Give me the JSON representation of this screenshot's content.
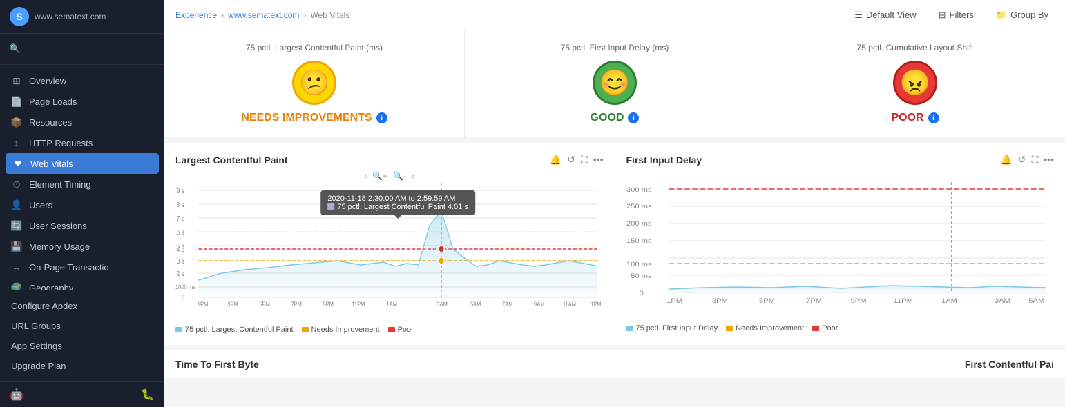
{
  "app": {
    "logo_text": "www.sematext.com",
    "logo_symbol": "S"
  },
  "sidebar": {
    "items": [
      {
        "id": "overview",
        "label": "Overview",
        "icon": "⊞"
      },
      {
        "id": "page-loads",
        "label": "Page Loads",
        "icon": "📄"
      },
      {
        "id": "resources",
        "label": "Resources",
        "icon": "📦"
      },
      {
        "id": "http-requests",
        "label": "HTTP Requests",
        "icon": "↕"
      },
      {
        "id": "web-vitals",
        "label": "Web Vitals",
        "icon": "❤"
      },
      {
        "id": "element-timing",
        "label": "Element Timing",
        "icon": "⏱"
      },
      {
        "id": "users",
        "label": "Users",
        "icon": "👤"
      },
      {
        "id": "user-sessions",
        "label": "User Sessions",
        "icon": "🔄"
      },
      {
        "id": "memory-usage",
        "label": "Memory Usage",
        "icon": "💾"
      },
      {
        "id": "on-page-transactions",
        "label": "On-Page Transactio",
        "icon": "↔"
      },
      {
        "id": "geography",
        "label": "Geography",
        "icon": "🌍"
      }
    ],
    "bottom_items": [
      {
        "id": "configure-apdex",
        "label": "Configure Apdex"
      },
      {
        "id": "url-groups",
        "label": "URL Groups"
      },
      {
        "id": "app-settings",
        "label": "App Settings"
      },
      {
        "id": "upgrade-plan",
        "label": "Upgrade Plan"
      }
    ]
  },
  "breadcrumb": {
    "items": [
      "Experience",
      "www.sematext.com",
      "Web Vitals"
    ]
  },
  "toolbar": {
    "default_view_label": "Default View",
    "filters_label": "Filters",
    "group_by_label": "Group By"
  },
  "score_cards": [
    {
      "title": "75 pctl. Largest Contentful Paint (ms)",
      "emoji": "😕",
      "emoji_style": "yellow",
      "label": "NEEDS IMPROVEMENTS",
      "label_style": "orange"
    },
    {
      "title": "75 pctl. First Input Delay (ms)",
      "emoji": "😊",
      "emoji_style": "green",
      "label": "GOOD",
      "label_style": "green"
    },
    {
      "title": "75 pctl. Cumulative Layout Shift",
      "emoji": "😠",
      "emoji_style": "red",
      "label": "POOR",
      "label_style": "red"
    }
  ],
  "charts": {
    "left": {
      "title": "Largest Contentful Paint",
      "tooltip": {
        "date": "2020-11-18 2:30:00 AM to 2:59:59 AM",
        "value": "75 pctl. Largest Contentful Paint  4.01 s"
      },
      "y_labels": [
        "9 s",
        "8 s",
        "7 s",
        "6 s",
        "5 s",
        "4 s",
        "3 s",
        "2 s",
        "1000 ms",
        "0"
      ],
      "x_labels": [
        "1PM",
        "3PM",
        "5PM",
        "7PM",
        "9PM",
        "11PM",
        "1AM",
        "3AM",
        "5AM",
        "7AM",
        "9AM",
        "11AM",
        "1PM"
      ],
      "legend": [
        {
          "label": "75 pctl. Largest Contentful Paint",
          "color": "#7ec8e3"
        },
        {
          "label": "Needs Improvement",
          "color": "#f0a500"
        },
        {
          "label": "Poor",
          "color": "#e53935"
        }
      ]
    },
    "right": {
      "title": "First Input Delay",
      "y_labels": [
        "300 ms",
        "250 ms",
        "200 ms",
        "150 ms",
        "100 ms",
        "50 ms",
        "0"
      ],
      "x_labels": [
        "1PM",
        "3PM",
        "5PM",
        "7PM",
        "9PM",
        "11PM",
        "1AM",
        "3AM",
        "5AM"
      ],
      "legend": [
        {
          "label": "75 pctl. First Input Delay",
          "color": "#7ec8e3"
        },
        {
          "label": "Needs Improvement",
          "color": "#f0a500"
        },
        {
          "label": "Poor",
          "color": "#e53935"
        }
      ]
    }
  },
  "bottom": {
    "left_title": "Time To First Byte",
    "right_title": "First Contentful Pai"
  }
}
